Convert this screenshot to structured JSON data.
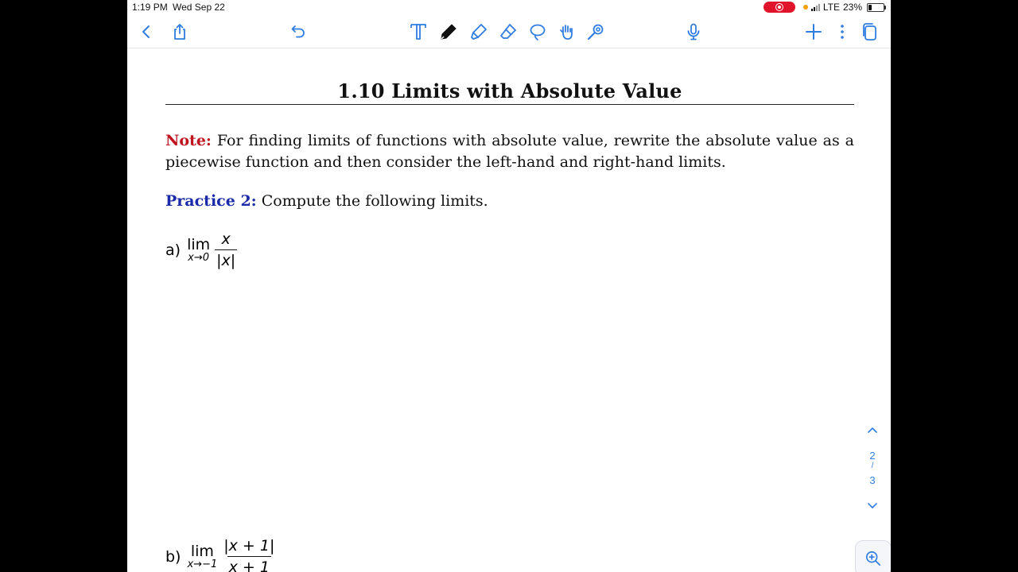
{
  "status_bar": {
    "time": "1:19 PM",
    "date": "Wed Sep 22",
    "network": "LTE",
    "battery": "23%",
    "battery_level": 0.23
  },
  "toolbar": {
    "left": [
      "back-chevron-icon",
      "share-icon",
      "undo-icon"
    ],
    "tools": [
      "text-tool-icon",
      "pen-tool-icon",
      "highlighter-icon",
      "eraser-icon",
      "lasso-icon",
      "hand-icon",
      "laser-pointer-icon"
    ],
    "right": [
      "microphone-icon",
      "plus-icon",
      "more-icon",
      "pages-icon"
    ],
    "accent_color": "#2f7de1"
  },
  "document": {
    "title": "1.10 Limits with Absolute Value",
    "note_label": "Note:",
    "note_text": "For finding limits of functions with absolute value, rewrite the absolute value as a piecewise function and then consider the left-hand and right-hand limits.",
    "practice_label": "Practice 2:",
    "practice_text": "Compute the following limits.",
    "problems": [
      {
        "label": "a)",
        "lim": "lim",
        "sub": "x→0",
        "numerator": "x",
        "denominator": "|x|"
      },
      {
        "label": "b)",
        "lim": "lim",
        "sub": "x→−1",
        "numerator": "|x + 1|",
        "denominator": "x + 1"
      }
    ],
    "note_color": "#c0141e",
    "practice_color": "#1b2aa8"
  },
  "pager": {
    "current": "2",
    "separator": "/",
    "total": "3"
  }
}
